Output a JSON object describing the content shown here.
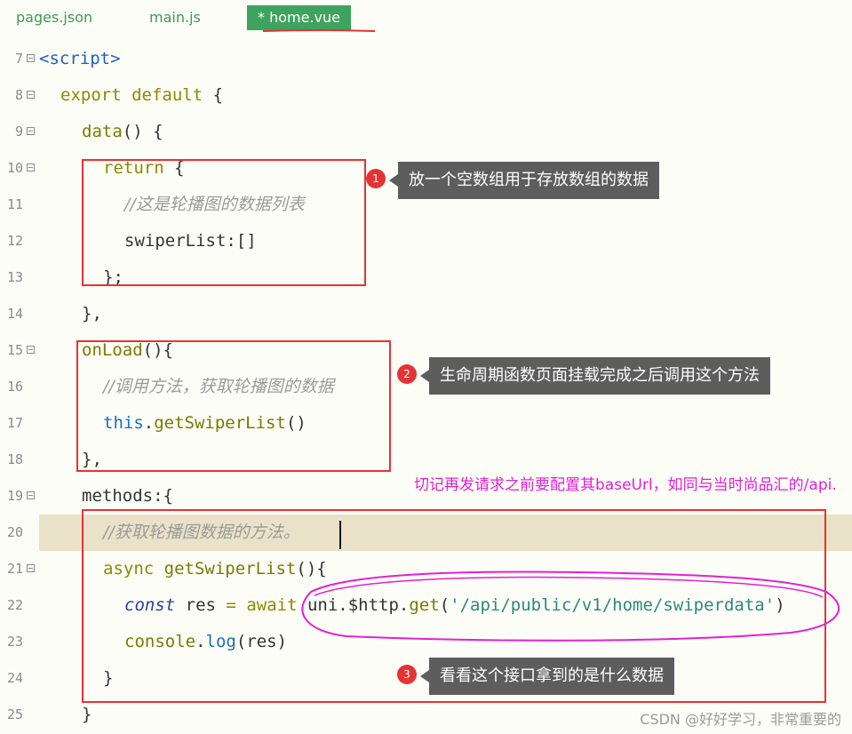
{
  "tabs": [
    {
      "label": "pages.json"
    },
    {
      "label": "main.js"
    },
    {
      "label": "* home.vue",
      "active": true
    }
  ],
  "lines": [
    {
      "num": "7",
      "fold": true,
      "tokens": [
        {
          "t": "<script>",
          "c": "tag"
        }
      ]
    },
    {
      "num": "8",
      "fold": true,
      "tokens": [
        {
          "t": "export default",
          "c": "kw"
        },
        {
          "t": " {",
          "c": "pl"
        }
      ]
    },
    {
      "num": "9",
      "fold": true,
      "tokens": [
        {
          "t": "data",
          "c": "fn"
        },
        {
          "t": "() {",
          "c": "pl"
        }
      ]
    },
    {
      "num": "10",
      "fold": true,
      "tokens": [
        {
          "t": "return",
          "c": "kw"
        },
        {
          "t": " {",
          "c": "pl"
        }
      ]
    },
    {
      "num": "11",
      "fold": false,
      "tokens": [
        {
          "t": "//这是轮播图的数据列表",
          "c": "cm"
        }
      ]
    },
    {
      "num": "12",
      "fold": false,
      "tokens": [
        {
          "t": "swiperList:[]",
          "c": "pl"
        }
      ]
    },
    {
      "num": "13",
      "fold": false,
      "tokens": [
        {
          "t": "};",
          "c": "pl"
        }
      ]
    },
    {
      "num": "14",
      "fold": false,
      "tokens": [
        {
          "t": "},",
          "c": "pl"
        }
      ]
    },
    {
      "num": "15",
      "fold": true,
      "tokens": [
        {
          "t": "onLoad",
          "c": "fn"
        },
        {
          "t": "(){",
          "c": "pl"
        }
      ]
    },
    {
      "num": "16",
      "fold": false,
      "tokens": [
        {
          "t": "//调用方法，获取轮播图的数据",
          "c": "cm"
        }
      ]
    },
    {
      "num": "17",
      "fold": false,
      "tokens": [
        {
          "t": "this",
          "c": "this"
        },
        {
          "t": ".",
          "c": "pl"
        },
        {
          "t": "getSwiperList",
          "c": "fn"
        },
        {
          "t": "()",
          "c": "pl"
        }
      ]
    },
    {
      "num": "18",
      "fold": false,
      "tokens": [
        {
          "t": "},",
          "c": "pl"
        }
      ]
    },
    {
      "num": "19",
      "fold": true,
      "tokens": [
        {
          "t": "methods:{",
          "c": "pl"
        }
      ]
    },
    {
      "num": "20",
      "fold": false,
      "tokens": [
        {
          "t": "//获取轮播图数据的方法。",
          "c": "cm"
        }
      ]
    },
    {
      "num": "21",
      "fold": true,
      "tokens": [
        {
          "t": "async",
          "c": "kw"
        },
        {
          "t": " ",
          "c": "pl"
        },
        {
          "t": "getSwiperList",
          "c": "fn"
        },
        {
          "t": "(){",
          "c": "pl"
        }
      ]
    },
    {
      "num": "22",
      "fold": false,
      "tokens": [
        {
          "t": "const",
          "c": "const"
        },
        {
          "t": " res ",
          "c": "pl"
        },
        {
          "t": "=",
          "c": "kw"
        },
        {
          "t": " ",
          "c": "pl"
        },
        {
          "t": "await",
          "c": "kw"
        },
        {
          "t": " uni.$http.",
          "c": "pl"
        },
        {
          "t": "get",
          "c": "fn"
        },
        {
          "t": "(",
          "c": "pl"
        },
        {
          "t": "'/api/public/v1/home/swiperdata'",
          "c": "str"
        },
        {
          "t": ")",
          "c": "pl"
        }
      ]
    },
    {
      "num": "23",
      "fold": false,
      "tokens": [
        {
          "t": "console",
          "c": "fn"
        },
        {
          "t": ".",
          "c": "pl"
        },
        {
          "t": "log",
          "c": "log"
        },
        {
          "t": "(res)",
          "c": "pl"
        }
      ]
    },
    {
      "num": "24",
      "fold": false,
      "tokens": [
        {
          "t": "}",
          "c": "pl"
        }
      ]
    },
    {
      "num": "25",
      "fold": false,
      "tokens": [
        {
          "t": "}",
          "c": "pl"
        }
      ]
    }
  ],
  "annotations": {
    "badge1": "1",
    "note1": "放一个空数组用于存放数组的数据",
    "badge2": "2",
    "note2": "生命周期函数页面挂载完成之后调用这个方法",
    "badge3": "3",
    "note3": "看看这个接口拿到的是什么数据",
    "pink_note": "切记再发请求之前要配置其baseUrl，如同与当时尚品汇的/api."
  },
  "watermark": "CSDN @好好学习，非常重要的",
  "colors": {
    "tab_active": "#3ea35f",
    "box_red": "#e53333",
    "note_pink": "#e021d6",
    "callout_bg": "#5d5d5d"
  }
}
